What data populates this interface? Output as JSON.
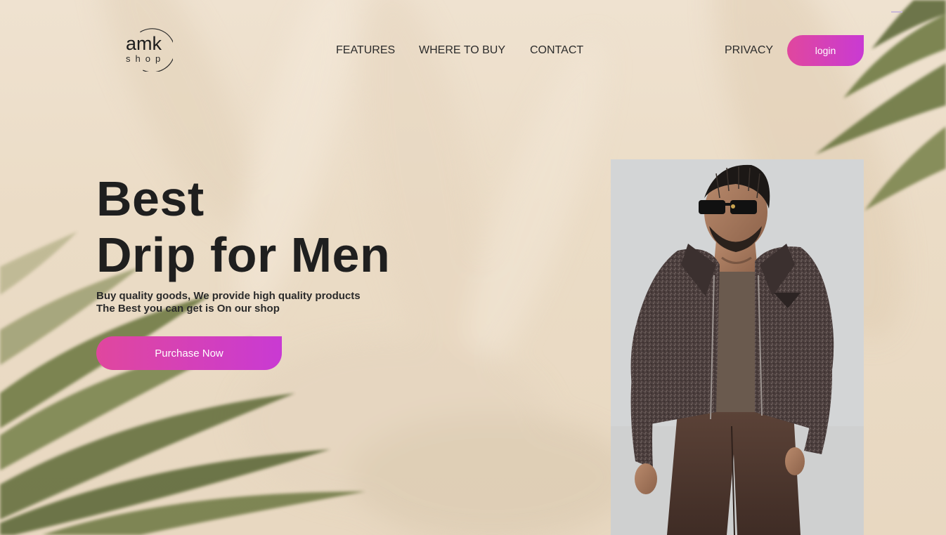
{
  "header": {
    "logo": {
      "title": "amk",
      "subtitle": "shop",
      "icon": "circle-logo-icon"
    },
    "nav": [
      {
        "label": "FEATURES"
      },
      {
        "label": "WHERE TO BUY"
      },
      {
        "label": "CONTACT"
      },
      {
        "label": "PRIVACY"
      }
    ],
    "login_label": "login"
  },
  "hero": {
    "title_line1": "Best",
    "title_line2": "Drip for Men",
    "subtitle_line1": "Buy quality goods, We provide high quality products",
    "subtitle_line2": "The Best you can get is On our shop",
    "cta_label": "Purchase Now"
  },
  "product_image": {
    "subject": "man-in-tweed-jacket-photo"
  },
  "colors": {
    "accent_start": "#e0479e",
    "accent_end": "#c93ad3",
    "background": "#efe2d0",
    "text": "#1f1f1f"
  }
}
